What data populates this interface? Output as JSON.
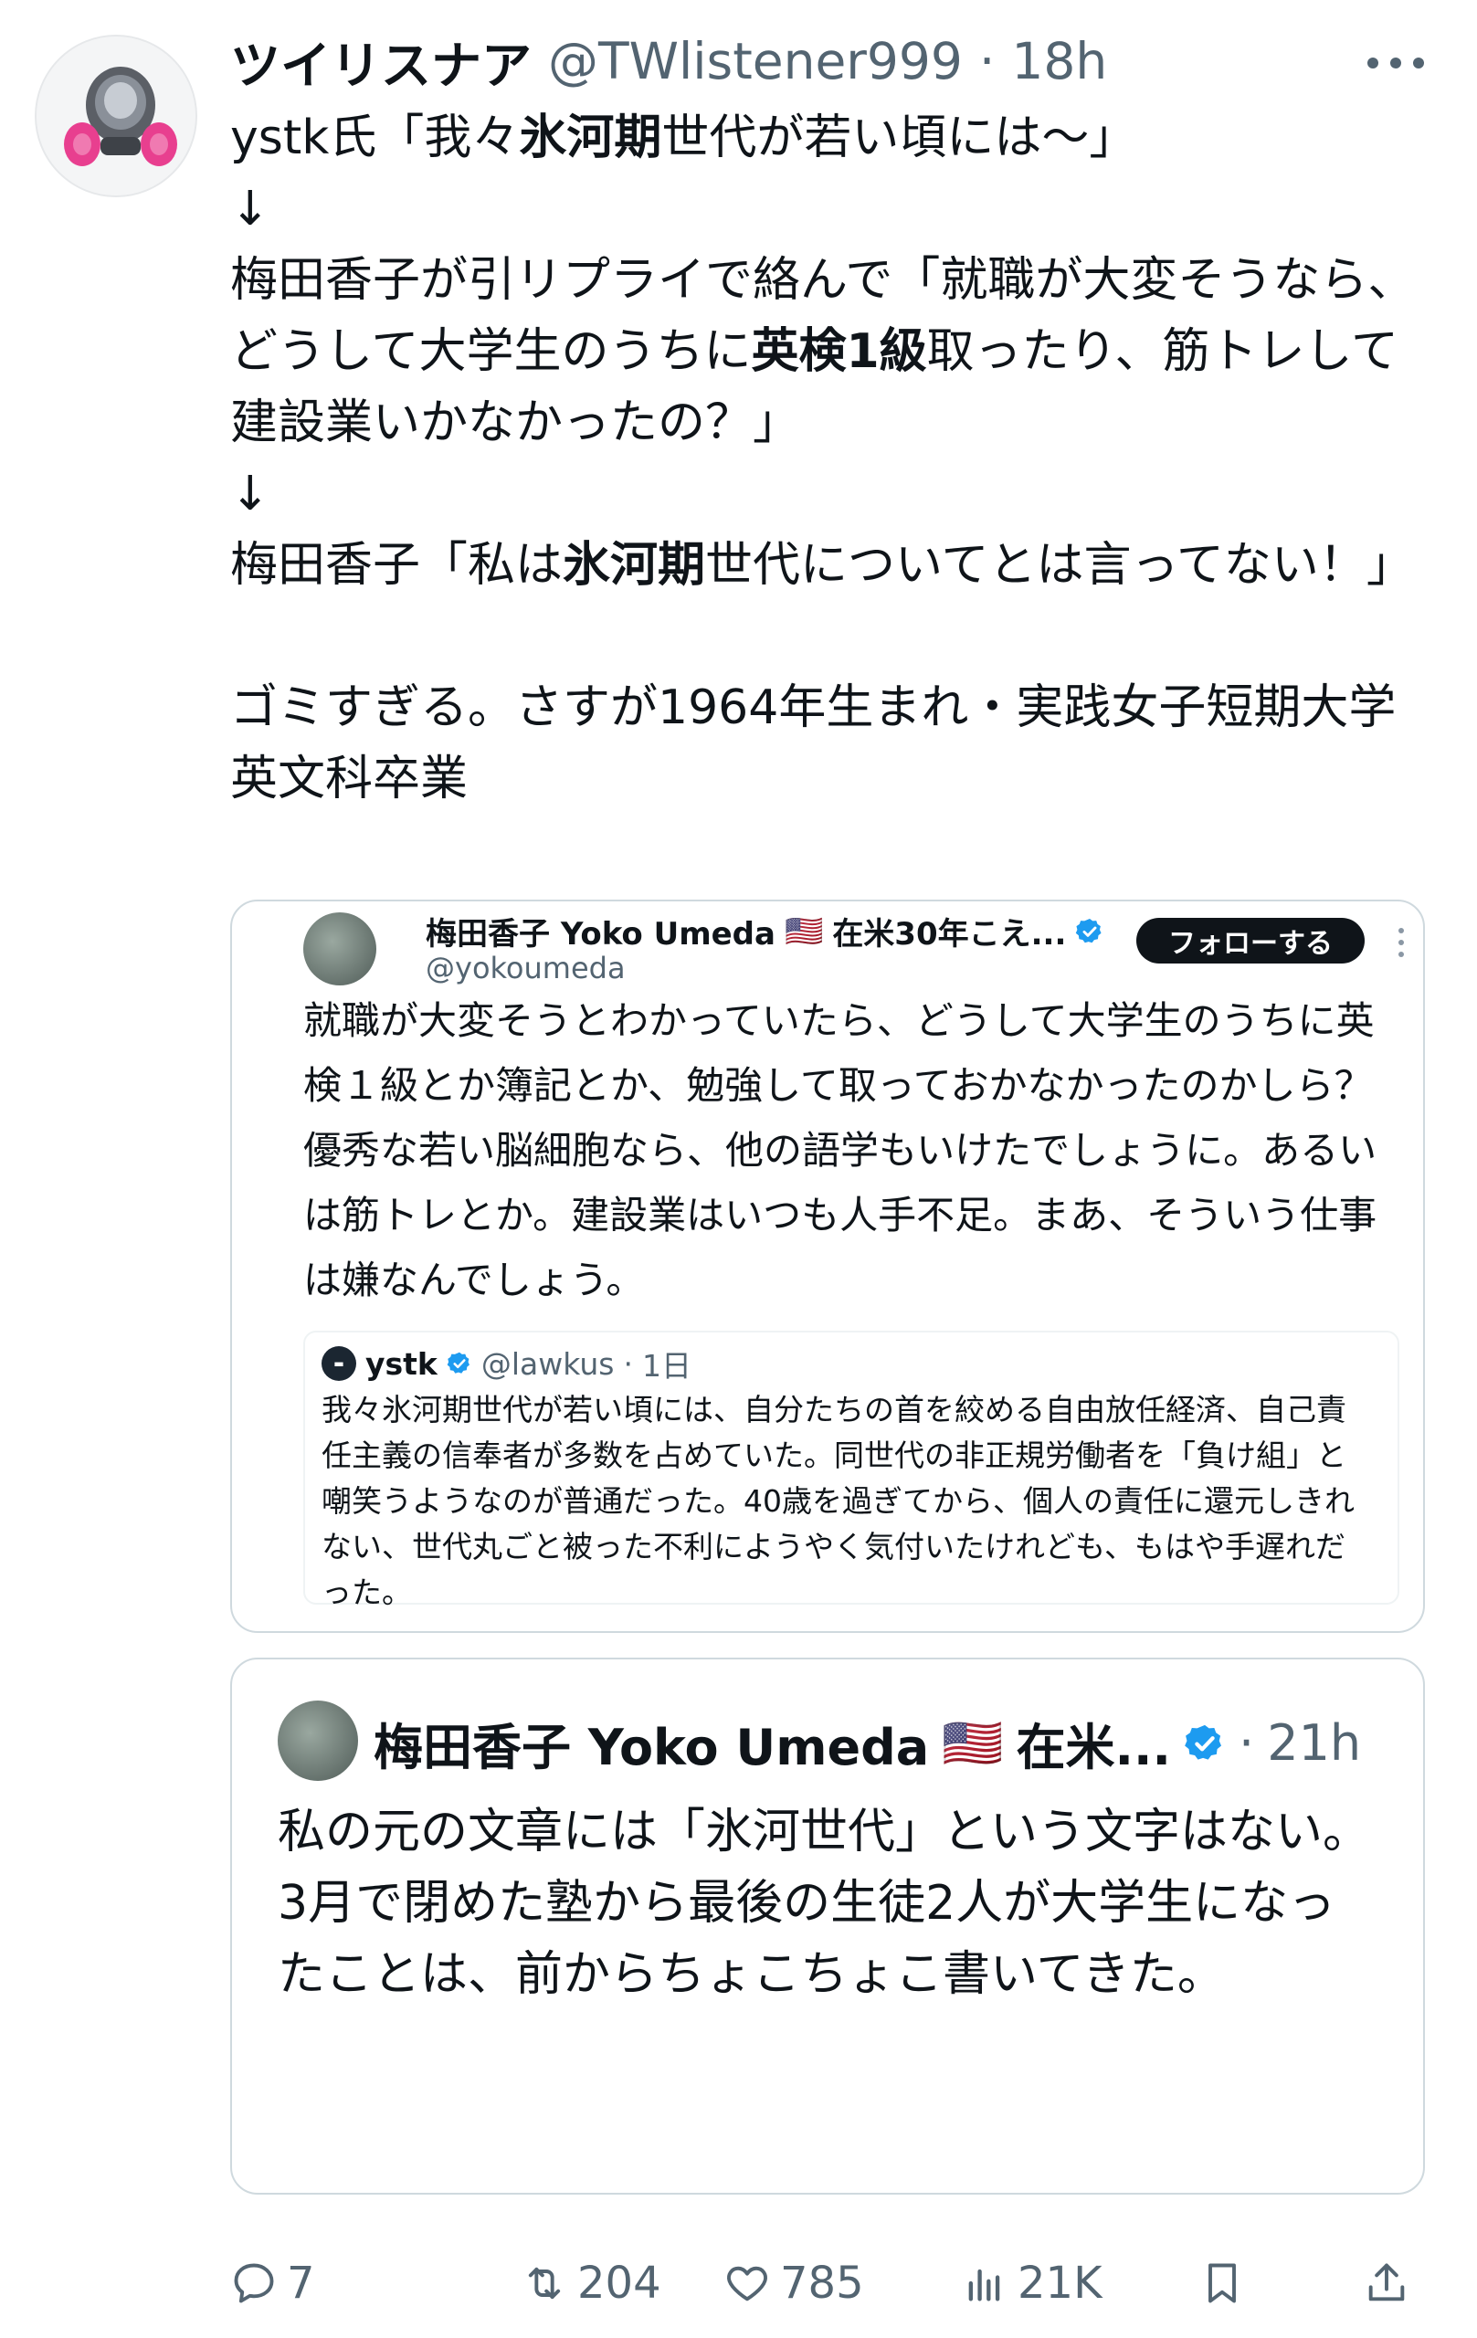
{
  "tweet": {
    "author_name": "ツイリスナア",
    "author_handle": "@TWlistener999",
    "separator": "·",
    "time": "18h",
    "lines": [
      [
        "ystk氏「我々",
        {
          "b": "氷河期"
        },
        "世代が若い頃には〜」"
      ],
      [
        "↓"
      ],
      [
        "梅田香子が引リプライで絡んで「就職が大変そうなら、どうして大学生のうちに",
        {
          "b": "英検1級"
        },
        "取ったり、筋トレして建設業いかなかったの？」"
      ],
      [
        "↓"
      ],
      [
        "梅田香子「私は",
        {
          "b": "氷河期"
        },
        "世代についてとは言ってない！」"
      ],
      [
        ""
      ],
      [
        "ゴミすぎる。さすが1964年生まれ・実践女子短期大学英文科卒業"
      ]
    ]
  },
  "quoted_tweet": {
    "author_name": "梅田香子 Yoko Umeda",
    "flag": "🇺🇸",
    "name_suffix": "在米30年こえ...",
    "author_handle": "@yokoumeda",
    "follow_label": "フォローする",
    "text": "就職が大変そうとわかっていたら、どうして大学生のうちに英検１級とか簿記とか、勉強して取っておかなかったのかしら？優秀な若い脳細胞なら、他の語学もいけたでしょうに。あるいは筋トレとか。建設業はいつも人手不足。まあ、そういう仕事は嫌なんでしょう。",
    "nested_quote": {
      "author_name": "ystk",
      "author_handle": "@lawkus",
      "separator": "·",
      "time": "1日",
      "text": "我々氷河期世代が若い頃には、自分たちの首を絞める自由放任経済、自己責任主義の信奉者が多数を占めていた。同世代の非正規労働者を「負け組」と嘲笑うようなのが普通だった。40歳を過ぎてから、個人の責任に還元しきれない、世代丸ごと被った不利にようやく気付いたけれども、もはや手遅れだった。"
    }
  },
  "reply_tweet": {
    "author_name": "梅田香子 Yoko Umeda",
    "flag": "🇺🇸",
    "name_suffix": "在米...",
    "separator": "·",
    "time": "21h",
    "lines": [
      "私の元の文章には「氷河世代」という文字はない。",
      "3月で閉めた塾から最後の生徒2人が大学生になったことは、前からちょこちょこ書いてきた。"
    ]
  },
  "actions": {
    "replies": "7",
    "retweets": "204",
    "likes": "785",
    "views": "21K"
  },
  "colors": {
    "text": "#0f1419",
    "secondary": "#536471",
    "border": "#cfd9de",
    "verified": "#1d9bf0",
    "mask_pink": "#e83f8f"
  }
}
